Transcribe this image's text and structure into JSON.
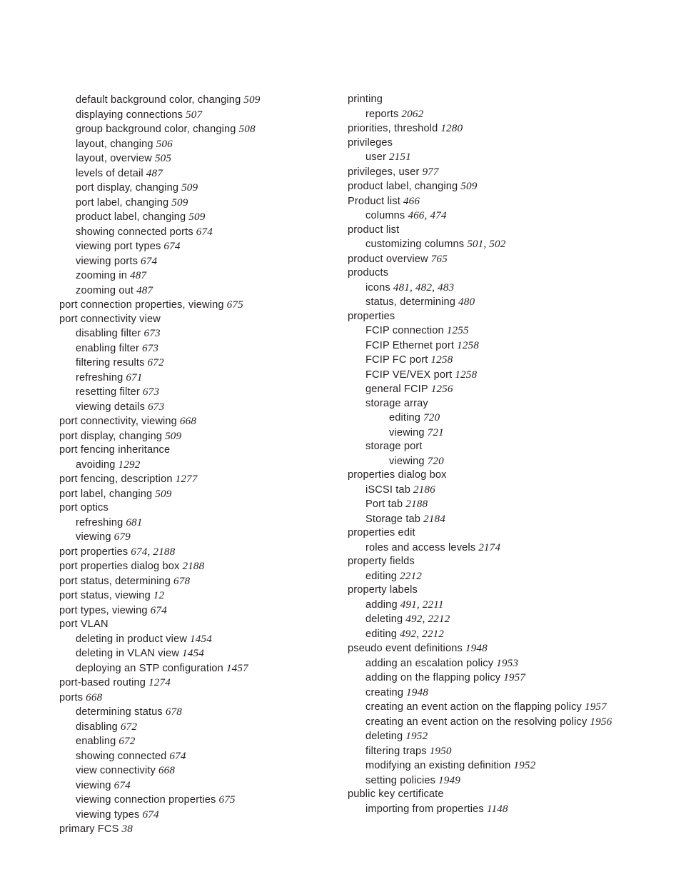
{
  "page": {
    "type": "book-index",
    "background_color": "#ffffff",
    "text_color": "#231f20",
    "columns": 2
  },
  "index": {
    "left_column": [
      {
        "level": 1,
        "term": "default background color, changing",
        "pages": "509"
      },
      {
        "level": 1,
        "term": "displaying connections",
        "pages": "507"
      },
      {
        "level": 1,
        "term": "group background color, changing",
        "pages": "508"
      },
      {
        "level": 1,
        "term": "layout, changing",
        "pages": "506"
      },
      {
        "level": 1,
        "term": "layout, overview",
        "pages": "505"
      },
      {
        "level": 1,
        "term": "levels of detail",
        "pages": "487"
      },
      {
        "level": 1,
        "term": "port display, changing",
        "pages": "509"
      },
      {
        "level": 1,
        "term": "port label, changing",
        "pages": "509"
      },
      {
        "level": 1,
        "term": "product label, changing",
        "pages": "509"
      },
      {
        "level": 1,
        "term": "showing connected ports",
        "pages": "674"
      },
      {
        "level": 1,
        "term": "viewing port types",
        "pages": "674"
      },
      {
        "level": 1,
        "term": "viewing ports",
        "pages": "674"
      },
      {
        "level": 1,
        "term": "zooming in",
        "pages": "487"
      },
      {
        "level": 1,
        "term": "zooming out",
        "pages": "487"
      },
      {
        "level": 0,
        "term": "port connection properties, viewing",
        "pages": "675"
      },
      {
        "level": 0,
        "term": "port connectivity view",
        "pages": ""
      },
      {
        "level": 1,
        "term": "disabling filter",
        "pages": "673"
      },
      {
        "level": 1,
        "term": "enabling filter",
        "pages": "673"
      },
      {
        "level": 1,
        "term": "filtering results",
        "pages": "672"
      },
      {
        "level": 1,
        "term": "refreshing",
        "pages": "671"
      },
      {
        "level": 1,
        "term": "resetting filter",
        "pages": "673"
      },
      {
        "level": 1,
        "term": "viewing details",
        "pages": "673"
      },
      {
        "level": 0,
        "term": "port connectivity, viewing",
        "pages": "668"
      },
      {
        "level": 0,
        "term": "port display, changing",
        "pages": "509"
      },
      {
        "level": 0,
        "term": "port fencing inheritance",
        "pages": ""
      },
      {
        "level": 1,
        "term": "avoiding",
        "pages": "1292"
      },
      {
        "level": 0,
        "term": "port fencing, description",
        "pages": "1277"
      },
      {
        "level": 0,
        "term": "port label, changing",
        "pages": "509"
      },
      {
        "level": 0,
        "term": "port optics",
        "pages": ""
      },
      {
        "level": 1,
        "term": "refreshing",
        "pages": "681"
      },
      {
        "level": 1,
        "term": "viewing",
        "pages": "679"
      },
      {
        "level": 0,
        "term": "port properties",
        "pages": "674, 2188"
      },
      {
        "level": 0,
        "term": "port properties dialog box",
        "pages": "2188"
      },
      {
        "level": 0,
        "term": "port status, determining",
        "pages": "678"
      },
      {
        "level": 0,
        "term": "port status, viewing",
        "pages": "12"
      },
      {
        "level": 0,
        "term": "port types, viewing",
        "pages": "674"
      },
      {
        "level": 0,
        "term": "port VLAN",
        "pages": ""
      },
      {
        "level": 1,
        "term": "deleting in product view",
        "pages": "1454"
      },
      {
        "level": 1,
        "term": "deleting in VLAN view",
        "pages": "1454"
      },
      {
        "level": 1,
        "term": "deploying an STP configuration",
        "pages": "1457"
      },
      {
        "level": 0,
        "term": "port-based routing",
        "pages": "1274"
      },
      {
        "level": 0,
        "term": "ports",
        "pages": "668"
      },
      {
        "level": 1,
        "term": "determining status",
        "pages": "678"
      },
      {
        "level": 1,
        "term": "disabling",
        "pages": "672"
      },
      {
        "level": 1,
        "term": "enabling",
        "pages": "672"
      },
      {
        "level": 1,
        "term": "showing connected",
        "pages": "674"
      },
      {
        "level": 1,
        "term": "view connectivity",
        "pages": "668"
      },
      {
        "level": 1,
        "term": "viewing",
        "pages": "674"
      },
      {
        "level": 1,
        "term": "viewing connection properties",
        "pages": "675"
      },
      {
        "level": 1,
        "term": "viewing types",
        "pages": "674"
      },
      {
        "level": 0,
        "term": "primary FCS",
        "pages": "38"
      }
    ],
    "right_column": [
      {
        "level": 0,
        "term": "printing",
        "pages": ""
      },
      {
        "level": 1,
        "term": "reports",
        "pages": "2062"
      },
      {
        "level": 0,
        "term": "priorities, threshold",
        "pages": "1280"
      },
      {
        "level": 0,
        "term": "privileges",
        "pages": ""
      },
      {
        "level": 1,
        "term": "user",
        "pages": "2151"
      },
      {
        "level": 0,
        "term": "privileges, user",
        "pages": "977"
      },
      {
        "level": 0,
        "term": "product label, changing",
        "pages": "509"
      },
      {
        "level": 0,
        "term": "Product list",
        "pages": "466"
      },
      {
        "level": 1,
        "term": "columns",
        "pages": "466, 474"
      },
      {
        "level": 0,
        "term": "product list",
        "pages": ""
      },
      {
        "level": 1,
        "term": "customizing columns",
        "pages": "501, 502"
      },
      {
        "level": 0,
        "term": "product overview",
        "pages": "765"
      },
      {
        "level": 0,
        "term": "products",
        "pages": ""
      },
      {
        "level": 1,
        "term": "icons",
        "pages": "481, 482, 483"
      },
      {
        "level": 1,
        "term": "status, determining",
        "pages": "480"
      },
      {
        "level": 0,
        "term": "properties",
        "pages": ""
      },
      {
        "level": 1,
        "term": "FCIP connection",
        "pages": "1255"
      },
      {
        "level": 1,
        "term": "FCIP Ethernet port",
        "pages": "1258"
      },
      {
        "level": 1,
        "term": "FCIP FC port",
        "pages": "1258"
      },
      {
        "level": 1,
        "term": "FCIP VE/VEX port",
        "pages": "1258"
      },
      {
        "level": 1,
        "term": "general FCIP",
        "pages": "1256"
      },
      {
        "level": 1,
        "term": "storage array",
        "pages": ""
      },
      {
        "level": 2,
        "term": "editing",
        "pages": "720"
      },
      {
        "level": 2,
        "term": "viewing",
        "pages": "721"
      },
      {
        "level": 1,
        "term": "storage port",
        "pages": ""
      },
      {
        "level": 2,
        "term": "viewing",
        "pages": "720"
      },
      {
        "level": 0,
        "term": "properties dialog box",
        "pages": ""
      },
      {
        "level": 1,
        "term": "iSCSI tab",
        "pages": "2186"
      },
      {
        "level": 1,
        "term": "Port tab",
        "pages": "2188"
      },
      {
        "level": 1,
        "term": "Storage tab",
        "pages": "2184"
      },
      {
        "level": 0,
        "term": "properties edit",
        "pages": ""
      },
      {
        "level": 1,
        "term": "roles and access levels",
        "pages": "2174"
      },
      {
        "level": 0,
        "term": "property fields",
        "pages": ""
      },
      {
        "level": 1,
        "term": "editing",
        "pages": "2212"
      },
      {
        "level": 0,
        "term": "property labels",
        "pages": ""
      },
      {
        "level": 1,
        "term": "adding",
        "pages": "491, 2211"
      },
      {
        "level": 1,
        "term": "deleting",
        "pages": "492, 2212"
      },
      {
        "level": 1,
        "term": "editing",
        "pages": "492, 2212"
      },
      {
        "level": 0,
        "term": "pseudo event definitions",
        "pages": "1948"
      },
      {
        "level": 1,
        "term": "adding an escalation policy",
        "pages": "1953"
      },
      {
        "level": 1,
        "term": "adding on the flapping policy",
        "pages": "1957"
      },
      {
        "level": 1,
        "term": "creating",
        "pages": "1948"
      },
      {
        "level": 1,
        "term": "creating an event action on the flapping policy",
        "pages": "1957"
      },
      {
        "level": 1,
        "term": "creating an event action on the resolving policy",
        "pages": "1956"
      },
      {
        "level": 1,
        "term": "deleting",
        "pages": "1952"
      },
      {
        "level": 1,
        "term": "filtering traps",
        "pages": "1950"
      },
      {
        "level": 1,
        "term": "modifying an existing definition",
        "pages": "1952"
      },
      {
        "level": 1,
        "term": "setting policies",
        "pages": "1949"
      },
      {
        "level": 0,
        "term": "public key certificate",
        "pages": ""
      },
      {
        "level": 1,
        "term": "importing from properties",
        "pages": "1148"
      }
    ]
  }
}
